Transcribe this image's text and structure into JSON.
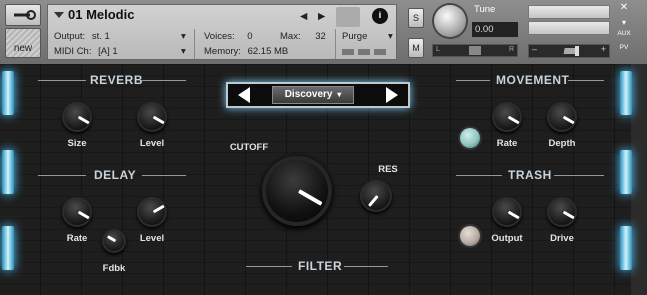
{
  "header": {
    "new_label": "new",
    "instrument_title": "01 Melodic",
    "output_label": "Output:",
    "output_value": "st. 1",
    "midi_label": "MIDI Ch:",
    "midi_value": "[A] 1",
    "voices_label": "Voices:",
    "voices_value": "0",
    "max_label": "Max:",
    "max_value": "32",
    "memory_label": "Memory:",
    "memory_value": "62.15 MB",
    "purge_label": "Purge",
    "solo_label": "S",
    "mute_label": "M",
    "tune_label": "Tune",
    "tune_value": "0.00",
    "pan_left": "L",
    "pan_right": "R",
    "aux_label": "AUX",
    "pv_label": "PV"
  },
  "reverb": {
    "title": "REVERB",
    "size_label": "Size",
    "level_label": "Level"
  },
  "delay": {
    "title": "DELAY",
    "rate_label": "Rate",
    "level_label": "Level",
    "fdbk_label": "Fdbk"
  },
  "preset": {
    "value": "Discovery"
  },
  "filter": {
    "title": "FILTER",
    "cutoff_label": "CUTOFF",
    "res_label": "RES"
  },
  "movement": {
    "title": "MOVEMENT",
    "rate_label": "Rate",
    "depth_label": "Depth"
  },
  "trash": {
    "title": "TRASH",
    "output_label": "Output",
    "drive_label": "Drive"
  },
  "colors": {
    "glow": "#4bc3ff",
    "led_movement": "#8fc6c0",
    "led_trash": "#b8ada4"
  }
}
